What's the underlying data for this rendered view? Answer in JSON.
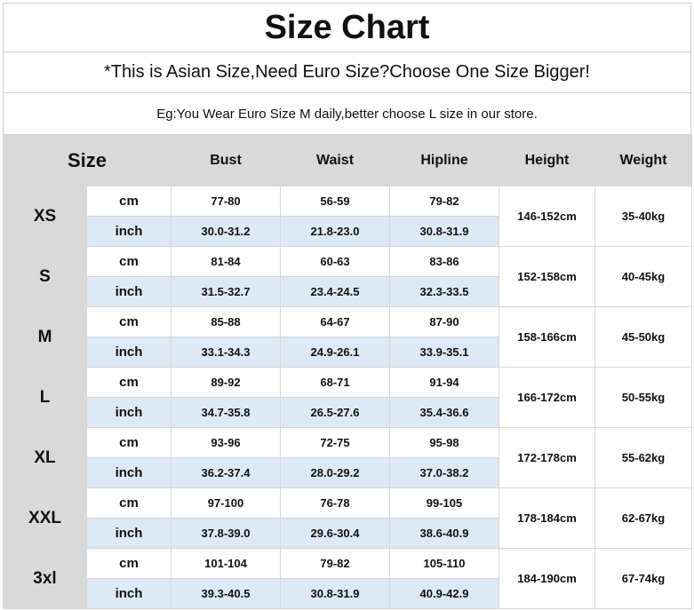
{
  "title": "Size Chart",
  "subtitle": "*This is Asian Size,Need Euro Size?Choose One Size Bigger!",
  "note": "Eg:You Wear Euro Size M daily,better choose L size in our store.",
  "columns": {
    "size": "Size",
    "bust": "Bust",
    "waist": "Waist",
    "hipline": "Hipline",
    "height": "Height",
    "weight": "Weight"
  },
  "units": {
    "cm": "cm",
    "inch": "inch"
  },
  "colors": {
    "header_bg": "#d9d9d9",
    "inch_row_bg": "#dde9f4",
    "border": "#d6d6d6"
  },
  "rows": [
    {
      "size": "XS",
      "cm": {
        "bust": "77-80",
        "waist": "56-59",
        "hipline": "79-82"
      },
      "inch": {
        "bust": "30.0-31.2",
        "waist": "21.8-23.0",
        "hipline": "30.8-31.9"
      },
      "height": "146-152cm",
      "weight": "35-40kg"
    },
    {
      "size": "S",
      "cm": {
        "bust": "81-84",
        "waist": "60-63",
        "hipline": "83-86"
      },
      "inch": {
        "bust": "31.5-32.7",
        "waist": "23.4-24.5",
        "hipline": "32.3-33.5"
      },
      "height": "152-158cm",
      "weight": "40-45kg"
    },
    {
      "size": "M",
      "cm": {
        "bust": "85-88",
        "waist": "64-67",
        "hipline": "87-90"
      },
      "inch": {
        "bust": "33.1-34.3",
        "waist": "24.9-26.1",
        "hipline": "33.9-35.1"
      },
      "height": "158-166cm",
      "weight": "45-50kg"
    },
    {
      "size": "L",
      "cm": {
        "bust": "89-92",
        "waist": "68-71",
        "hipline": "91-94"
      },
      "inch": {
        "bust": "34.7-35.8",
        "waist": "26.5-27.6",
        "hipline": "35.4-36.6"
      },
      "height": "166-172cm",
      "weight": "50-55kg"
    },
    {
      "size": "XL",
      "cm": {
        "bust": "93-96",
        "waist": "72-75",
        "hipline": "95-98"
      },
      "inch": {
        "bust": "36.2-37.4",
        "waist": "28.0-29.2",
        "hipline": "37.0-38.2"
      },
      "height": "172-178cm",
      "weight": "55-62kg"
    },
    {
      "size": "XXL",
      "cm": {
        "bust": "97-100",
        "waist": "76-78",
        "hipline": "99-105"
      },
      "inch": {
        "bust": "37.8-39.0",
        "waist": "29.6-30.4",
        "hipline": "38.6-40.9"
      },
      "height": "178-184cm",
      "weight": "62-67kg"
    },
    {
      "size": "3xl",
      "cm": {
        "bust": "101-104",
        "waist": "79-82",
        "hipline": "105-110"
      },
      "inch": {
        "bust": "39.3-40.5",
        "waist": "30.8-31.9",
        "hipline": "40.9-42.9"
      },
      "height": "184-190cm",
      "weight": "67-74kg"
    }
  ]
}
